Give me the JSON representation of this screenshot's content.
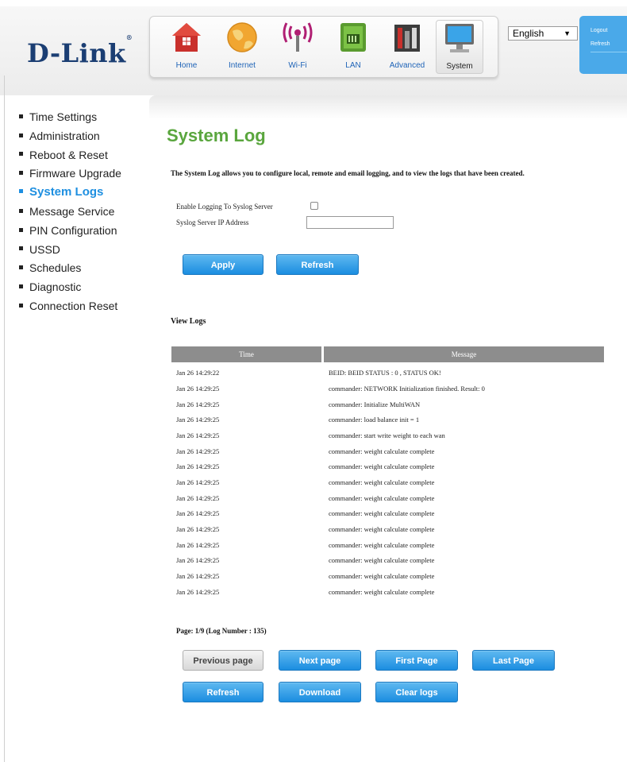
{
  "brand": {
    "name": "D-Link",
    "mark": "®"
  },
  "nav": {
    "items": [
      {
        "label": "Home",
        "icon": "home-icon"
      },
      {
        "label": "Internet",
        "icon": "globe-icon"
      },
      {
        "label": "Wi-Fi",
        "icon": "wifi-icon"
      },
      {
        "label": "LAN",
        "icon": "lan-icon"
      },
      {
        "label": "Advanced",
        "icon": "tools-icon"
      },
      {
        "label": "System",
        "icon": "computer-icon"
      }
    ],
    "active": "System"
  },
  "language": {
    "selected": "English",
    "arrow": "▼"
  },
  "session": {
    "logout": "Logout",
    "refresh": "Refresh"
  },
  "sidebar": {
    "items": [
      {
        "label": "Time Settings"
      },
      {
        "label": "Administration"
      },
      {
        "label": "Reboot & Reset"
      },
      {
        "label": "Firmware Upgrade"
      },
      {
        "label": "System Logs"
      },
      {
        "label": "Message Service"
      },
      {
        "label": "PIN Configuration"
      },
      {
        "label": "USSD"
      },
      {
        "label": "Schedules"
      },
      {
        "label": "Diagnostic"
      },
      {
        "label": "Connection Reset"
      }
    ],
    "active": "System Logs"
  },
  "page": {
    "title": "System Log",
    "description": "The System Log allows you to configure local, remote and email logging, and to view the logs that have been created."
  },
  "form": {
    "enable_label": "Enable Logging To Syslog Server",
    "enable_checked": false,
    "ip_label": "Syslog Server IP Address",
    "ip_value": "",
    "apply_button": "Apply",
    "refresh_button": "Refresh"
  },
  "logs": {
    "heading": "View Logs",
    "columns": [
      "Time",
      "Message"
    ],
    "rows": [
      {
        "time": "Jan 26 14:29:22",
        "message": "BEID: BEID STATUS : 0 , STATUS OK!"
      },
      {
        "time": "Jan 26 14:29:25",
        "message": "commander: NETWORK Initialization finished. Result: 0"
      },
      {
        "time": "Jan 26 14:29:25",
        "message": "commander: Initialize MultiWAN"
      },
      {
        "time": "Jan 26 14:29:25",
        "message": "commander: load balance init = 1"
      },
      {
        "time": "Jan 26 14:29:25",
        "message": "commander: start write weight to each wan"
      },
      {
        "time": "Jan 26 14:29:25",
        "message": "commander: weight calculate complete"
      },
      {
        "time": "Jan 26 14:29:25",
        "message": "commander: weight calculate complete"
      },
      {
        "time": "Jan 26 14:29:25",
        "message": "commander: weight calculate complete"
      },
      {
        "time": "Jan 26 14:29:25",
        "message": "commander: weight calculate complete"
      },
      {
        "time": "Jan 26 14:29:25",
        "message": "commander: weight calculate complete"
      },
      {
        "time": "Jan 26 14:29:25",
        "message": "commander: weight calculate complete"
      },
      {
        "time": "Jan 26 14:29:25",
        "message": "commander: weight calculate complete"
      },
      {
        "time": "Jan 26 14:29:25",
        "message": "commander: weight calculate complete"
      },
      {
        "time": "Jan 26 14:29:25",
        "message": "commander: weight calculate complete"
      },
      {
        "time": "Jan 26 14:29:25",
        "message": "commander: weight calculate complete"
      }
    ],
    "page_info": "Page: 1/9 (Log Number : 135)"
  },
  "pager": {
    "previous": "Previous page",
    "next": "Next page",
    "first": "First Page",
    "last": "Last Page",
    "refresh": "Refresh",
    "download": "Download",
    "clear": "Clear logs"
  },
  "colors": {
    "accent_blue": "#1e8fe0",
    "title_green": "#5aa63e",
    "brand_navy": "#1b3e73"
  }
}
